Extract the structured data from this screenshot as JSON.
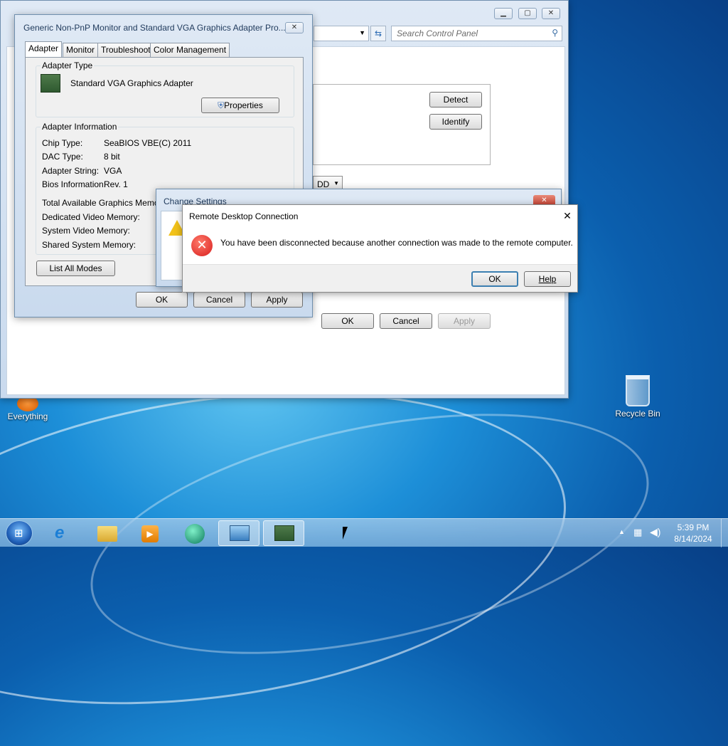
{
  "desktop": {
    "icons": [
      {
        "label": "Everything"
      },
      {
        "label": "Recycle Bin"
      }
    ]
  },
  "control_panel": {
    "search_placeholder": "Search Control Panel",
    "detect": "Detect",
    "identify": "Identify",
    "dropdown_value": "DD",
    "ok": "OK",
    "cancel": "Cancel",
    "apply": "Apply"
  },
  "adapter_props": {
    "title": "Generic Non-PnP Monitor and Standard VGA Graphics Adapter Pro...",
    "tabs": [
      "Adapter",
      "Monitor",
      "Troubleshoot",
      "Color Management"
    ],
    "adapter_type_label": "Adapter Type",
    "adapter_name": "Standard VGA Graphics Adapter",
    "properties_btn": "Properties",
    "adapter_info_label": "Adapter Information",
    "info": [
      {
        "key": "Chip Type:",
        "value": "SeaBIOS VBE(C) 2011"
      },
      {
        "key": "DAC Type:",
        "value": "8 bit"
      },
      {
        "key": "Adapter String:",
        "value": "VGA"
      },
      {
        "key": "Bios Information:",
        "value": "Rev. 1"
      }
    ],
    "memory": [
      "Total Available Graphics Memory:",
      "Dedicated Video Memory:",
      "System Video Memory:",
      "Shared System Memory:"
    ],
    "list_all_modes": "List All Modes",
    "ok": "OK",
    "cancel": "Cancel",
    "apply": "Apply"
  },
  "change_settings": {
    "title": "Change Settings"
  },
  "rdc": {
    "title": "Remote Desktop Connection",
    "message": "You have been disconnected because another connection was made to the remote computer.",
    "ok": "OK",
    "help": "Help"
  },
  "taskbar": {
    "time": "5:39 PM",
    "date": "8/14/2024"
  }
}
